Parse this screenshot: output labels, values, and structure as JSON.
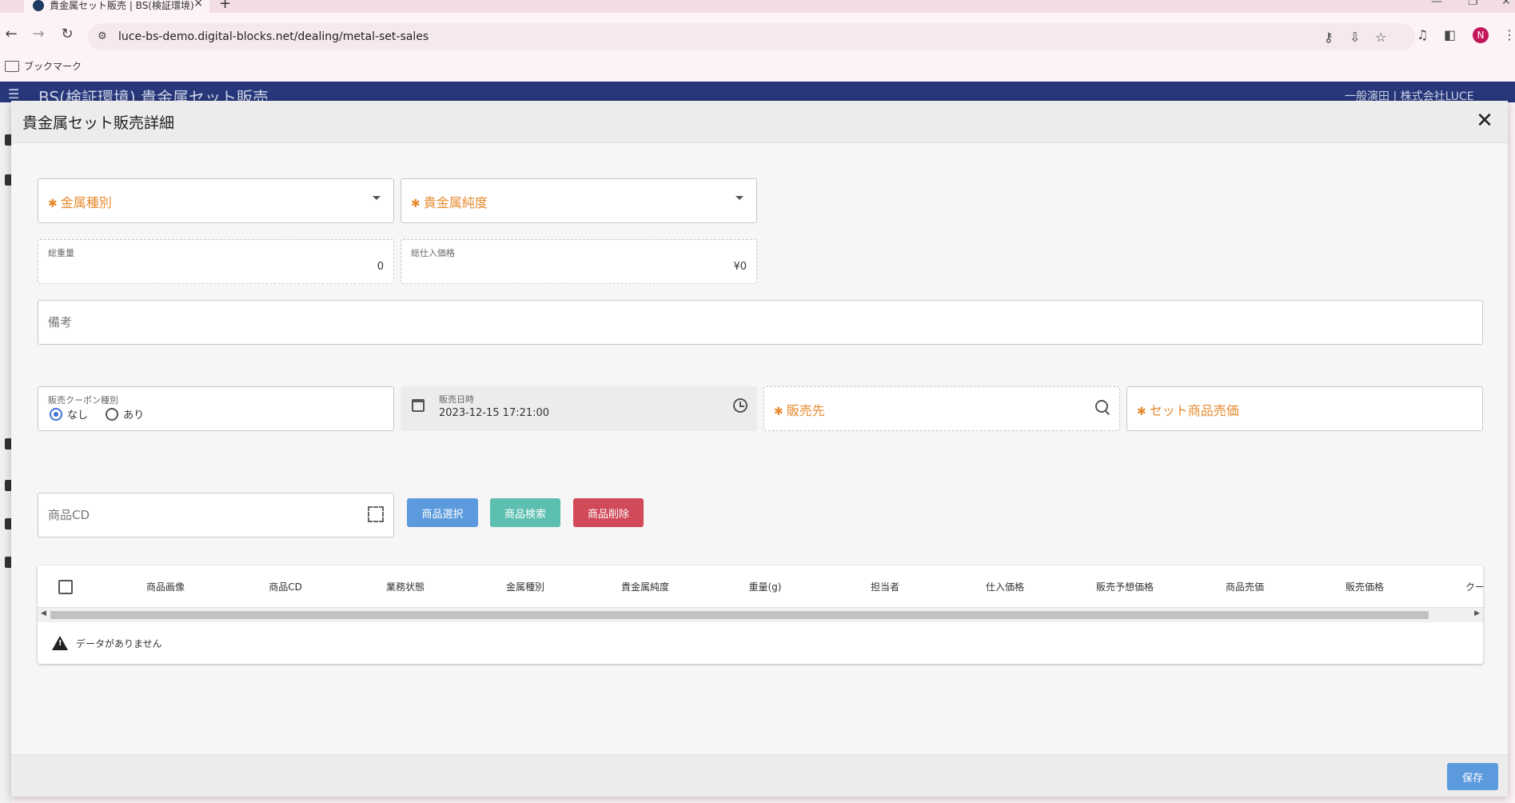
{
  "browser": {
    "tab_title": "貴金属セット販売 | BS(検証環境)",
    "url": "luce-bs-demo.digital-blocks.net/dealing/metal-set-sales",
    "bookmark_label": "ブックマーク",
    "profile_initial": "N"
  },
  "app": {
    "title": "BS(検証環境) 貴金属セット販売",
    "user": "一般演田 | 株式会社LUCE"
  },
  "modal": {
    "title": "貴金属セット販売詳細",
    "close_icon": "close-icon",
    "metal_type": {
      "label": "金属種別",
      "required": true
    },
    "metal_purity": {
      "label": "貴金属純度",
      "required": true
    },
    "total_weight": {
      "label": "総重量",
      "value": "0"
    },
    "total_purchase_price": {
      "label": "総仕入価格",
      "value": "¥0"
    },
    "notes": {
      "placeholder": "備考"
    },
    "coupon_type": {
      "label": "販売クーポン種別",
      "options": [
        "なし",
        "あり"
      ],
      "selected": "なし"
    },
    "sale_datetime": {
      "label": "販売日時",
      "value": "2023-12-15 17:21:00"
    },
    "customer": {
      "label": "販売先",
      "required": true
    },
    "set_price": {
      "label": "セット商品売価",
      "required": true
    },
    "product_cd": {
      "placeholder": "商品CD"
    },
    "buttons": {
      "select": "商品選択",
      "search": "商品検索",
      "delete": "商品削除",
      "save": "保存"
    },
    "colors": {
      "select": "#5b9bdd",
      "search": "#5dbfb0",
      "delete": "#d04a5a",
      "required": "#e68a2e"
    },
    "table": {
      "columns": [
        "商品画像",
        "商品CD",
        "業務状態",
        "金属種別",
        "貴金属純度",
        "重量(g)",
        "担当者",
        "仕入価格",
        "販売予想価格",
        "商品売価",
        "販売価格",
        "クーポン"
      ],
      "empty_message": "データがありません"
    }
  }
}
